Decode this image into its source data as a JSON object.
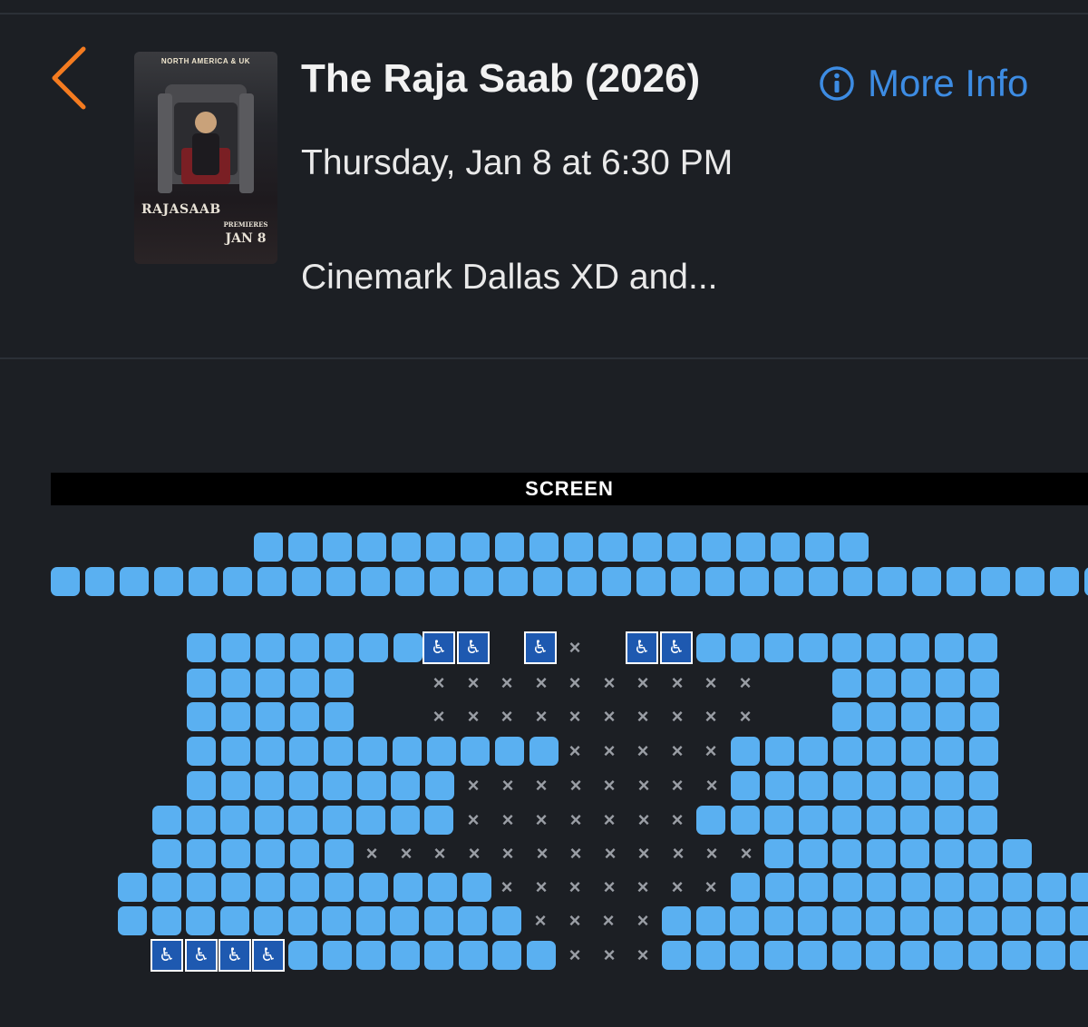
{
  "header": {
    "back_icon": "chevron-left-icon",
    "title": "The Raja Saab (2026)",
    "more_info_label": "More Info",
    "info_icon": "info-circle-icon",
    "showtime": "Thursday, Jan 8 at 6:30 PM",
    "theater": "Cinemark Dallas XD and...",
    "accent_color": "#f47b20",
    "link_color": "#3d8ce3"
  },
  "poster": {
    "top_text": "NORTH AMERICA & UK",
    "title_text": "RAJASAAB",
    "premieres_text": "PREMIERES",
    "date_text": "JAN 8"
  },
  "seatmap": {
    "screen_label": "SCREEN",
    "legend": {
      "available_color": "#5ab0f1",
      "unavailable_symbol": "×",
      "wheelchair_icon": "wheelchair-icon",
      "companion_icon": "companion-seat-icon"
    },
    "rows": [
      [
        [
          "S",
          280,
          18,
          38
        ]
      ],
      [
        [
          "S",
          56,
          31,
          38
        ]
      ],
      [
        [
          "S",
          206,
          7,
          38
        ],
        [
          "C",
          468
        ],
        [
          "W",
          506
        ],
        [
          "W",
          580
        ],
        [
          "X",
          618
        ],
        [
          "W",
          692
        ],
        [
          "C",
          730
        ],
        [
          "S",
          768,
          9,
          37.5
        ]
      ],
      [
        [
          "S",
          206,
          5,
          38
        ],
        [
          "X",
          468,
          10,
          37.5
        ],
        [
          "S",
          918,
          5,
          38
        ]
      ],
      [
        [
          "S",
          206,
          5,
          38
        ],
        [
          "X",
          468,
          10,
          37.5
        ],
        [
          "S",
          918,
          5,
          38
        ]
      ],
      [
        [
          "S",
          206,
          11,
          37.8
        ],
        [
          "X",
          618,
          5,
          37.5
        ],
        [
          "S",
          806,
          8,
          37.5
        ]
      ],
      [
        [
          "S",
          206,
          8,
          37.5
        ],
        [
          "X",
          506,
          8,
          37.5
        ],
        [
          "S",
          806,
          8,
          37.5
        ]
      ],
      [
        [
          "S",
          168,
          9,
          37.5
        ],
        [
          "X",
          506,
          7,
          37.5
        ],
        [
          "S",
          768,
          9,
          37.5
        ]
      ],
      [
        [
          "S",
          168,
          6,
          38
        ],
        [
          "X",
          394,
          12,
          37.5
        ],
        [
          "S",
          843,
          8,
          37.5
        ]
      ],
      [
        [
          "S",
          130,
          11,
          38
        ],
        [
          "X",
          543,
          7,
          37.5
        ],
        [
          "S",
          806,
          11,
          37.5
        ]
      ],
      [
        [
          "S",
          130,
          12,
          37.5
        ],
        [
          "X",
          580,
          4,
          37.5
        ],
        [
          "S",
          730,
          13,
          37.5
        ]
      ],
      [
        [
          "C",
          168
        ],
        [
          "W",
          206
        ],
        [
          "W",
          243
        ],
        [
          "C",
          280
        ],
        [
          "S",
          318,
          8,
          37.5
        ],
        [
          "X",
          618,
          3,
          37.5
        ],
        [
          "S",
          730,
          13,
          37.5
        ]
      ]
    ]
  }
}
